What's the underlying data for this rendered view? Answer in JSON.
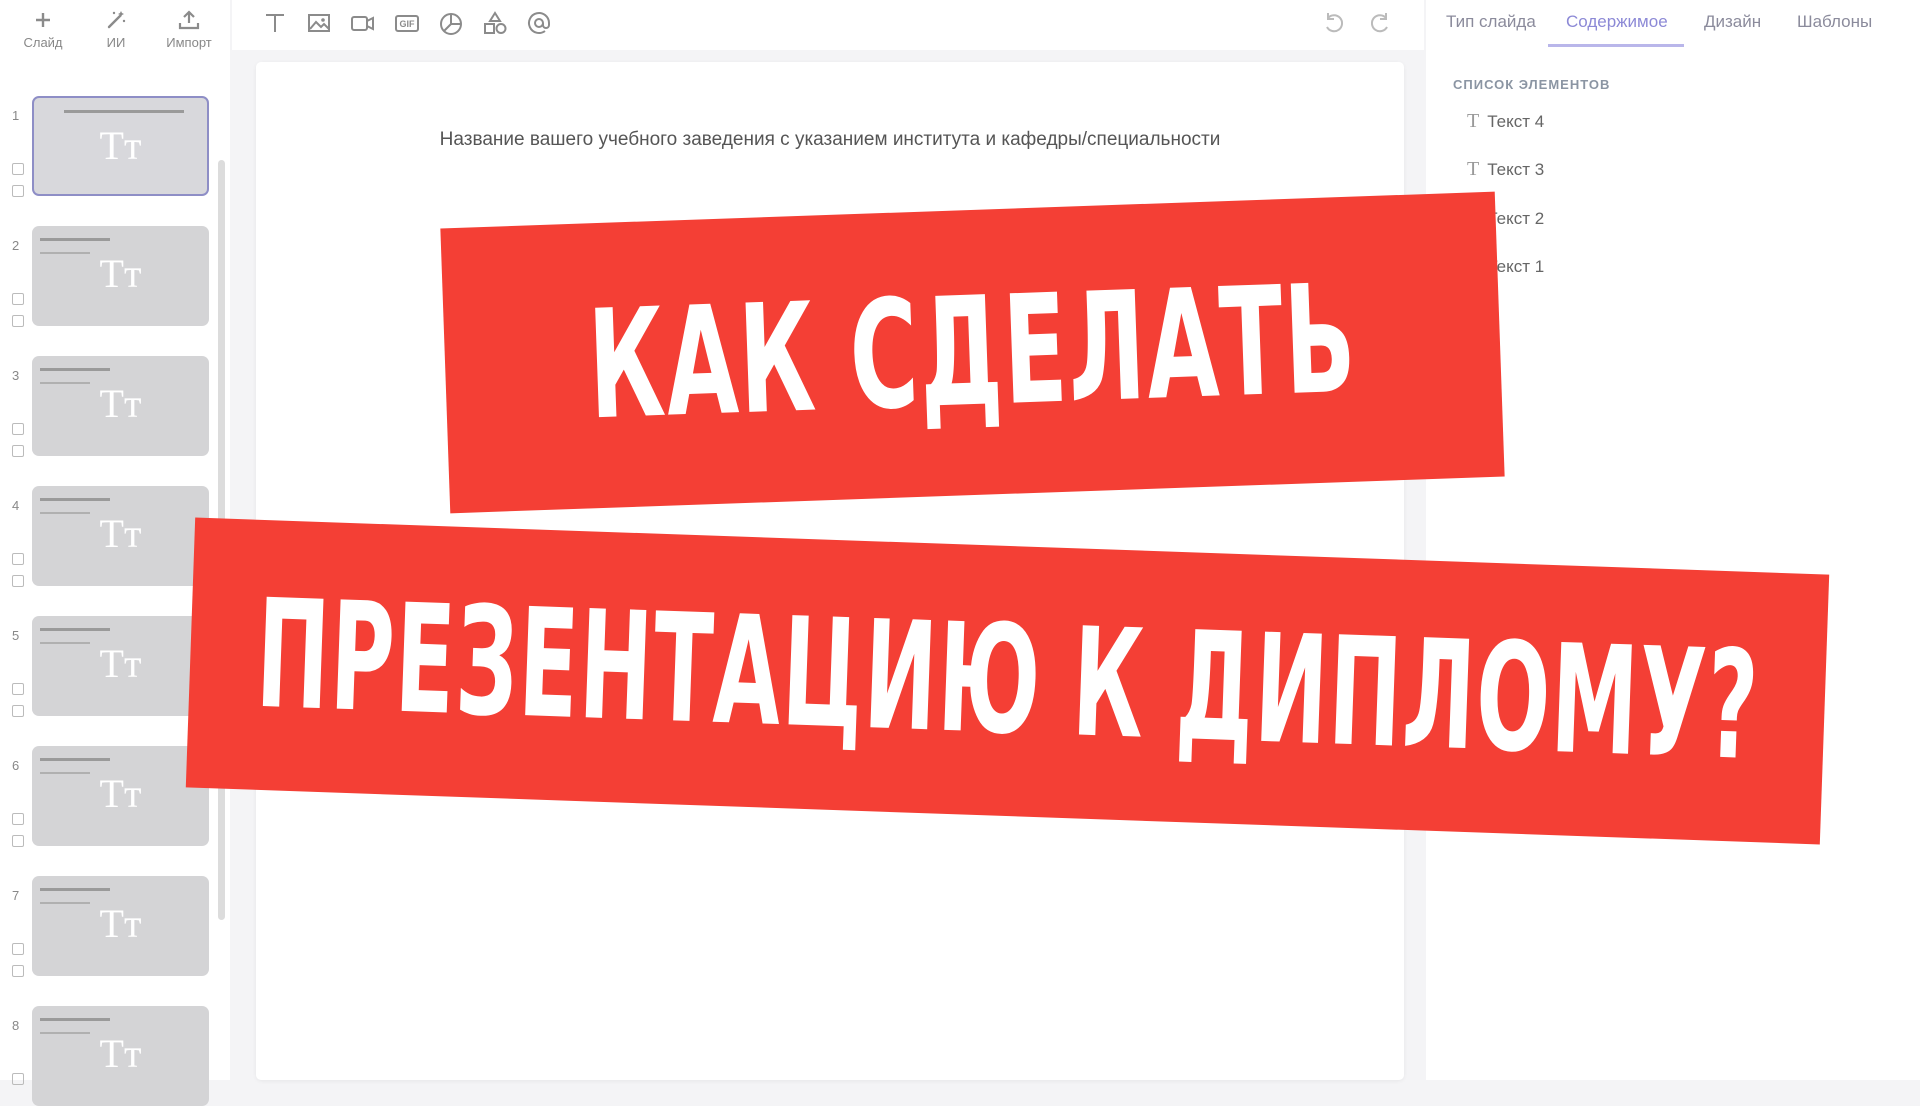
{
  "top_actions": [
    {
      "label": "Слайд",
      "icon": "plus-icon"
    },
    {
      "label": "ИИ",
      "icon": "magic-wand-icon"
    },
    {
      "label": "Импорт",
      "icon": "upload-icon"
    }
  ],
  "slides": [
    {
      "number": "1",
      "glyph": "Tт"
    },
    {
      "number": "2",
      "glyph": "Tт"
    },
    {
      "number": "3",
      "glyph": "Tт"
    },
    {
      "number": "4",
      "glyph": "Tт"
    },
    {
      "number": "5",
      "glyph": "Tт"
    },
    {
      "number": "6",
      "glyph": "Tт"
    },
    {
      "number": "7",
      "glyph": "Tт"
    },
    {
      "number": "8",
      "glyph": "Tт"
    }
  ],
  "toolbar": {
    "tools": [
      "text-tool-icon",
      "image-tool-icon",
      "video-tool-icon",
      "gif-tool-icon",
      "chart-tool-icon",
      "shapes-tool-icon",
      "mention-tool-icon"
    ],
    "gif_label": "GIF",
    "undo_icon": "undo-icon",
    "redo_icon": "redo-icon"
  },
  "slide": {
    "title_text": "Название вашего учебного заведения с указанием института и кафедры/специальности"
  },
  "right_panel": {
    "tabs": [
      "Тип слайда",
      "Содержимое",
      "Дизайн",
      "Шаблоны"
    ],
    "active_tab": "Содержимое",
    "section_title": "СПИСОК ЭЛЕМЕНТОВ",
    "elements": [
      "Текст 4",
      "Текст 3",
      "Текст 2",
      "Текст 1"
    ],
    "element_icon": "T"
  },
  "overlay": {
    "line1": "КАК СДЕЛАТЬ",
    "line2": "ПРЕЗЕНТАЦИЮ К ДИПЛОМУ?",
    "color": "#f43f35"
  }
}
